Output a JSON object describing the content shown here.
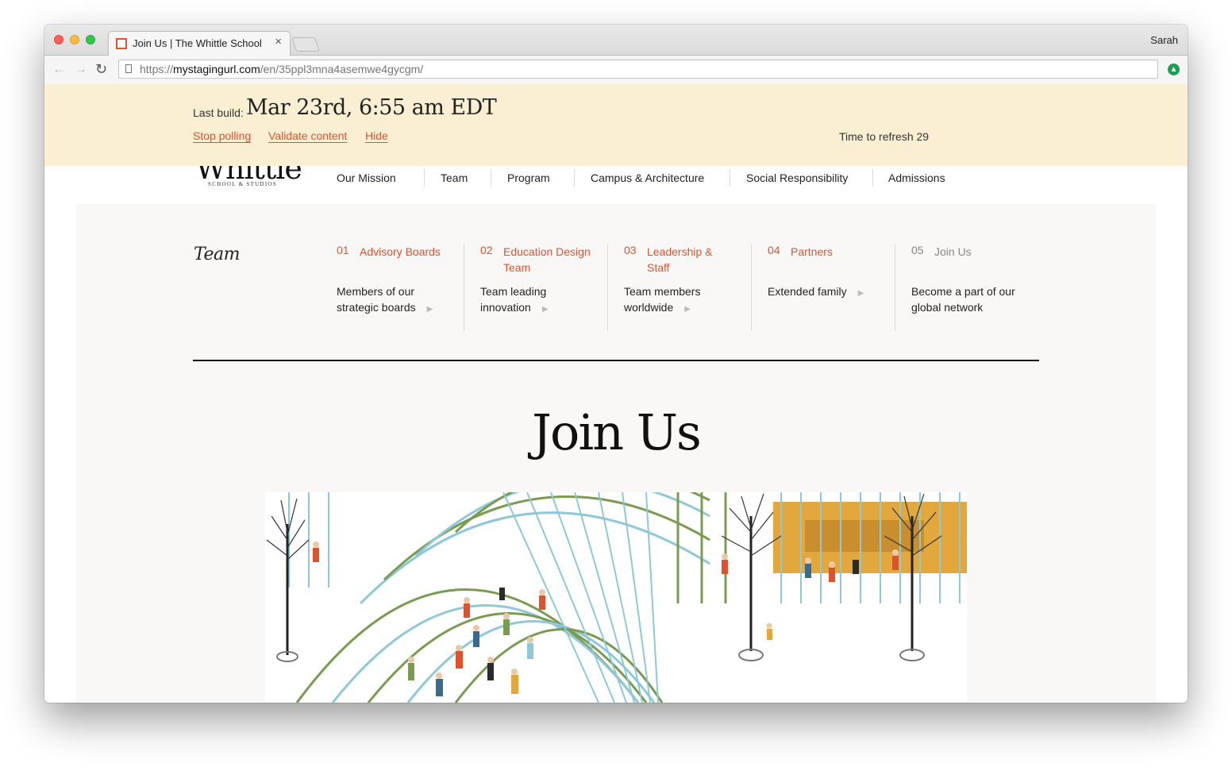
{
  "browser": {
    "tab_title": "Join Us | The Whittle School",
    "tab_close": "×",
    "profile_name": "Sarah",
    "url_prefix": "https://",
    "url_domain": "mystagingurl.com",
    "url_path": "/en/35ppl3mna4asemwe4gycgm/",
    "icons": [
      "back-arrow-icon",
      "forward-arrow-icon",
      "reload-icon",
      "page-icon",
      "extension-icon"
    ]
  },
  "banner": {
    "last_build_label": "Last build:",
    "last_build_date": "Mar 23rd, 6:55 am EDT",
    "links": [
      "Stop polling",
      "Validate content",
      "Hide"
    ],
    "refresh_text": "Time to refresh 29"
  },
  "logo": {
    "word": "Whittle",
    "subtitle": "SCHOOL & STUDIOS"
  },
  "nav": {
    "items": [
      "Our Mission",
      "Team",
      "Program",
      "Campus & Architecture",
      "Social Responsibility",
      "Admissions"
    ]
  },
  "section": {
    "title": "Team",
    "columns": [
      {
        "num": "01",
        "name": "Advisory Boards",
        "desc": "Members of our strategic boards"
      },
      {
        "num": "02",
        "name": "Education Design Team",
        "desc": "Team leading innovation"
      },
      {
        "num": "03",
        "name": "Leadership & Staff",
        "desc": "Team members worldwide"
      },
      {
        "num": "04",
        "name": "Partners",
        "desc": "Extended family"
      },
      {
        "num": "05",
        "name": "Join Us",
        "desc": "Become a part of our global network"
      }
    ]
  },
  "page": {
    "heading": "Join Us",
    "hero_image": "campus-illustration"
  },
  "colors": {
    "accent": "#d9542f",
    "banner_bg": "#faefd2",
    "panel_bg": "#f9f8f7"
  }
}
